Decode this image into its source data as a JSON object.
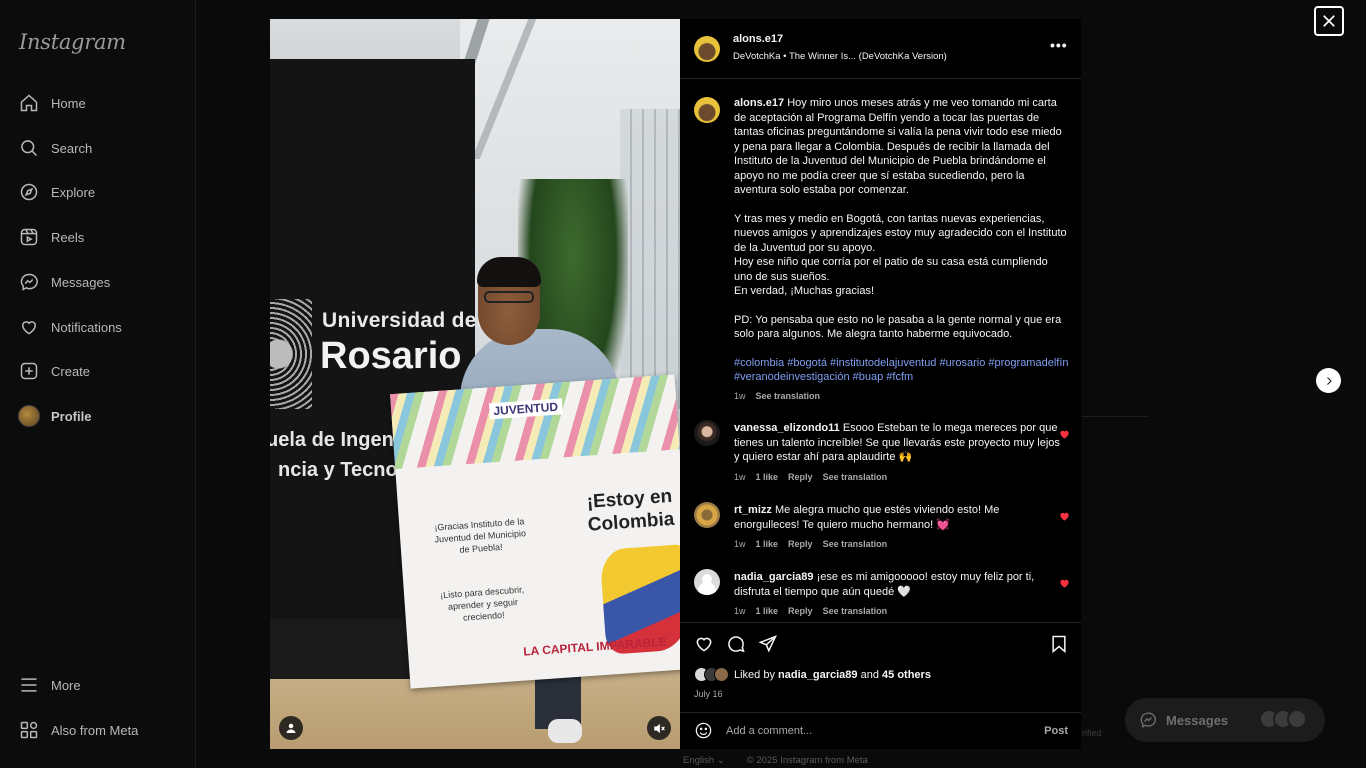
{
  "brand": {
    "logo_text": "Instagram"
  },
  "sidebar": {
    "items": [
      {
        "label": "Home",
        "icon": "home-icon"
      },
      {
        "label": "Search",
        "icon": "search-icon"
      },
      {
        "label": "Explore",
        "icon": "compass-icon"
      },
      {
        "label": "Reels",
        "icon": "reels-icon"
      },
      {
        "label": "Messages",
        "icon": "messenger-icon"
      },
      {
        "label": "Notifications",
        "icon": "heart-icon"
      },
      {
        "label": "Create",
        "icon": "plus-square-icon"
      },
      {
        "label": "Profile",
        "icon": "avatar"
      }
    ],
    "bottom": [
      {
        "label": "More",
        "icon": "menu-icon"
      },
      {
        "label": "Also from Meta",
        "icon": "meta-grid-icon"
      }
    ]
  },
  "background": {
    "verified_text": "rified"
  },
  "footer": {
    "language": "English ⌄",
    "copyright": "© 2025 Instagram from Meta"
  },
  "messages_pill": {
    "label": "Messages"
  },
  "post": {
    "author": "alons.e17",
    "audio": "DeVotchKa • The Winner Is... (DeVotchKa Version)",
    "more_label": "•••",
    "media": {
      "sign_line1": "Universidad del",
      "sign_line2": "Rosario",
      "sign_line3": "uela de Ingeni",
      "sign_line4": "ncia y Tecnolog",
      "flag_org": "JUVENTUD",
      "flag_gracias": "¡Gracias Instituto de la Juventud del Municipio de Puebla!",
      "flag_listo": "¡Listo para descubrir, aprender y seguir creciendo!",
      "flag_estoy": "¡Estoy en Colombia",
      "flag_capital": "LA CAPITAL IMPARABLE"
    },
    "caption": {
      "username": "alons.e17",
      "p1": "Hoy miro unos meses atrás y me veo tomando mi carta de aceptación al Programa Delfín yendo a tocar las puertas de tantas oficinas preguntándome si valía la pena vivir todo ese miedo y pena para llegar a Colombia. Después de recibir la llamada del Instituto de la Juventud del Municipio de Puebla brindándome el apoyo no me podía creer que sí estaba sucediendo, pero la aventura solo estaba por comenzar.",
      "p2": "Y tras mes y medio en Bogotá, con tantas nuevas experiencias, nuevos amigos y aprendizajes estoy muy agradecido con el Instituto de la Juventud por su apoyo.\nHoy ese niño que corría por el patio de su casa está cumpliendo uno de sus sueños.\nEn verdad, ¡Muchas gracias!",
      "p3": "PD: Yo pensaba que esto no le pasaba a la gente normal y que era solo para algunos. Me alegra tanto haberme equivocado.",
      "tags": "#colombia #bogotá #institutodelajuventud #urosario #programadelfín #veranodeinvestigación #buap #fcfm",
      "time": "1w",
      "translate": "See translation"
    },
    "comments": [
      {
        "username": "vanessa_elizondo11",
        "text": "Esooo Esteban te lo mega mereces por que tienes un talento increíble! Se que llevarás este proyecto muy lejos y quiero estar ahí para aplaudirte 🙌",
        "time": "1w",
        "likes": "1 like",
        "reply": "Reply",
        "translate": "See translation"
      },
      {
        "username": "rt_mizz",
        "text": "Me alegra mucho que estés viviendo esto! Me enorgulleces! Te quiero mucho hermano! 💓",
        "time": "1w",
        "likes": "1 like",
        "reply": "Reply",
        "translate": "See translation"
      },
      {
        "username": "nadia_garcia89",
        "text": "¡ese es mi amigooooo! estoy muy feliz por ti, disfruta el tiempo que aún quedé 🤍",
        "time": "1w",
        "likes": "1 like",
        "reply": "Reply",
        "translate": "See translation"
      }
    ],
    "likes": {
      "prefix": "Liked by",
      "user": "nadia_garcia89",
      "and": "and",
      "others": "45 others"
    },
    "date": "July 16",
    "comment_box": {
      "placeholder": "Add a comment...",
      "post_label": "Post"
    }
  },
  "colors": {
    "accent_link": "#7f9ff2",
    "heart": "#ff3040",
    "background": "#000000"
  }
}
